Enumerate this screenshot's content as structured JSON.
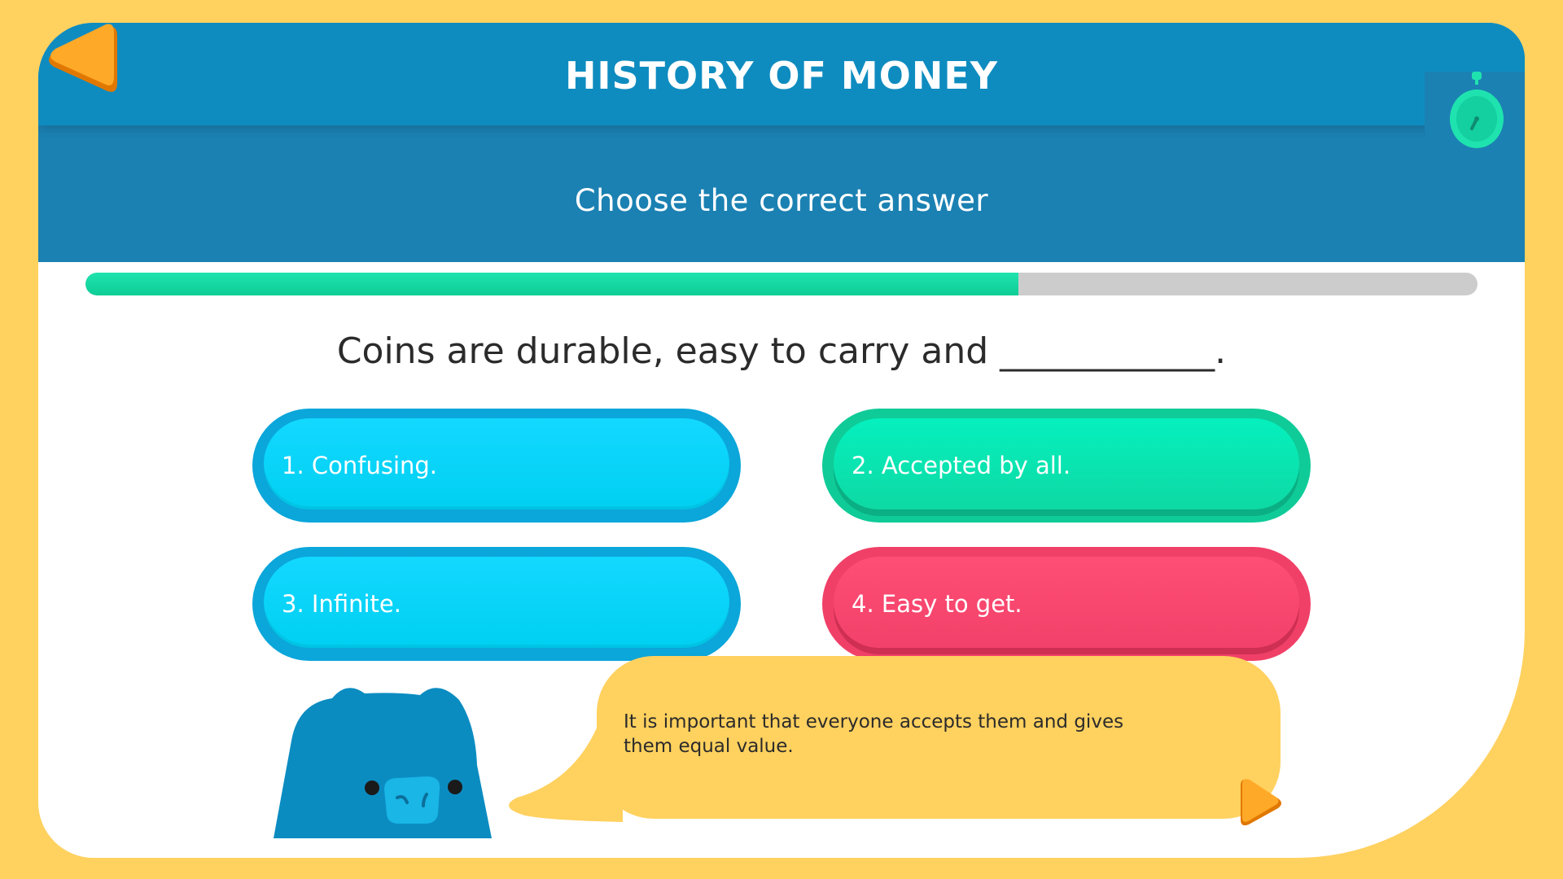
{
  "header": {
    "title": "HISTORY OF MONEY",
    "subtitle": "Choose the correct answer"
  },
  "icons": {
    "back": "back-arrow-icon",
    "timer": "stopwatch-icon",
    "next": "play-next-icon"
  },
  "progress": {
    "fraction": 0.67
  },
  "question": "Coins are durable, easy to carry and ____________.",
  "answers": [
    {
      "label": "1. Confusing.",
      "color": "#13D8FF"
    },
    {
      "label": "2. Accepted by all.",
      "color": "#05F0BE"
    },
    {
      "label": "3. Infinite.",
      "color": "#13D8FF"
    },
    {
      "label": "4. Easy to get.",
      "color": "#FF4E75"
    }
  ],
  "hint": "It is important that everyone accepts them and gives them equal value.",
  "colors": {
    "background": "#FFD15F",
    "header": "#1B81B2",
    "accent_orange": "#FF9F1A",
    "progress": "#1FE3AE"
  }
}
